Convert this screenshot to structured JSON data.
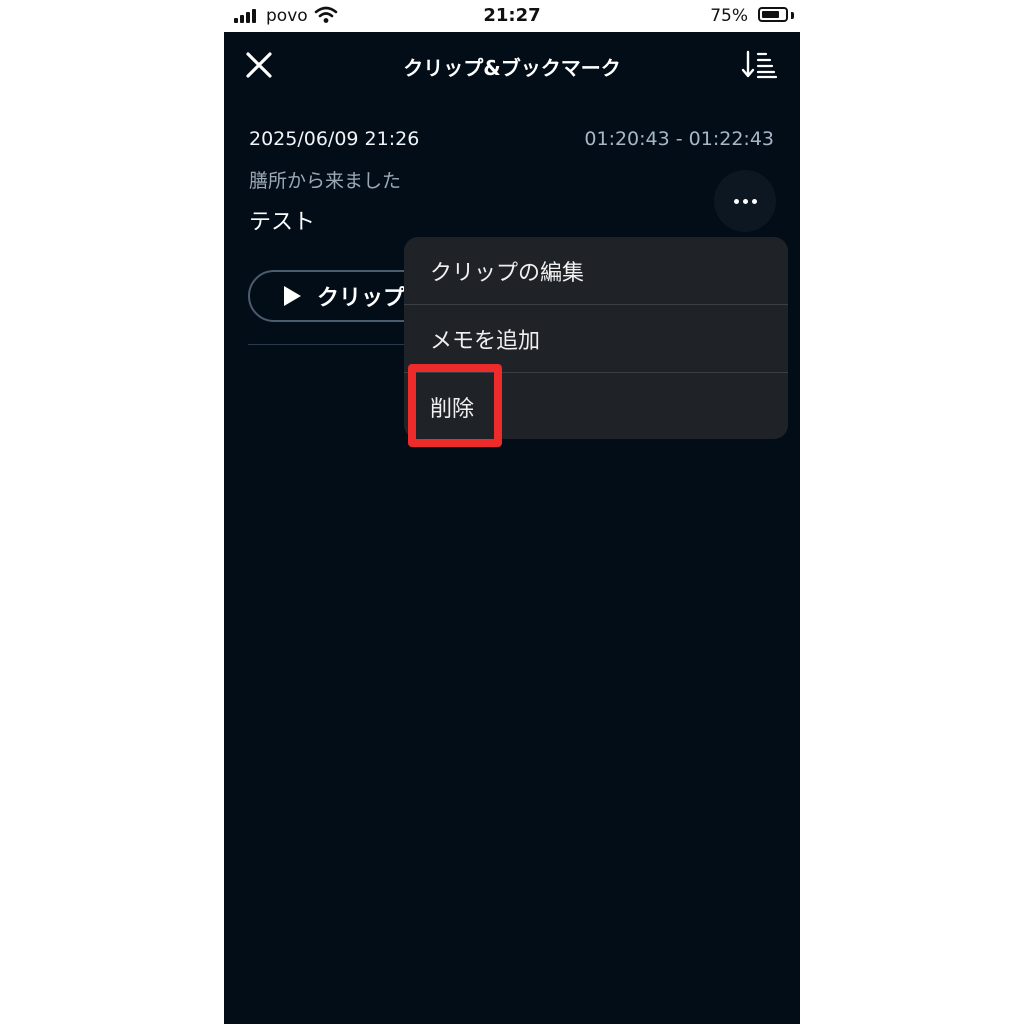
{
  "status_bar": {
    "carrier": "povo",
    "time": "21:27",
    "battery": "75%",
    "battery_level": 0.75
  },
  "header": {
    "title": "クリップ&ブックマーク",
    "close_icon": "close-icon",
    "sort_icon": "sort-icon"
  },
  "clip": {
    "date": "2025/06/09 21:26",
    "time_range": "01:20:43 - 01:22:43",
    "subtitle": "膳所から来ました",
    "memo": "テスト",
    "play_label": "クリップ"
  },
  "menu": {
    "items": [
      {
        "label": "クリップの編集"
      },
      {
        "label": "メモを追加"
      },
      {
        "label": "削除"
      }
    ]
  },
  "colors": {
    "background": "#020d17",
    "menu": "#1f2227",
    "highlight": "#ee2b2b"
  }
}
